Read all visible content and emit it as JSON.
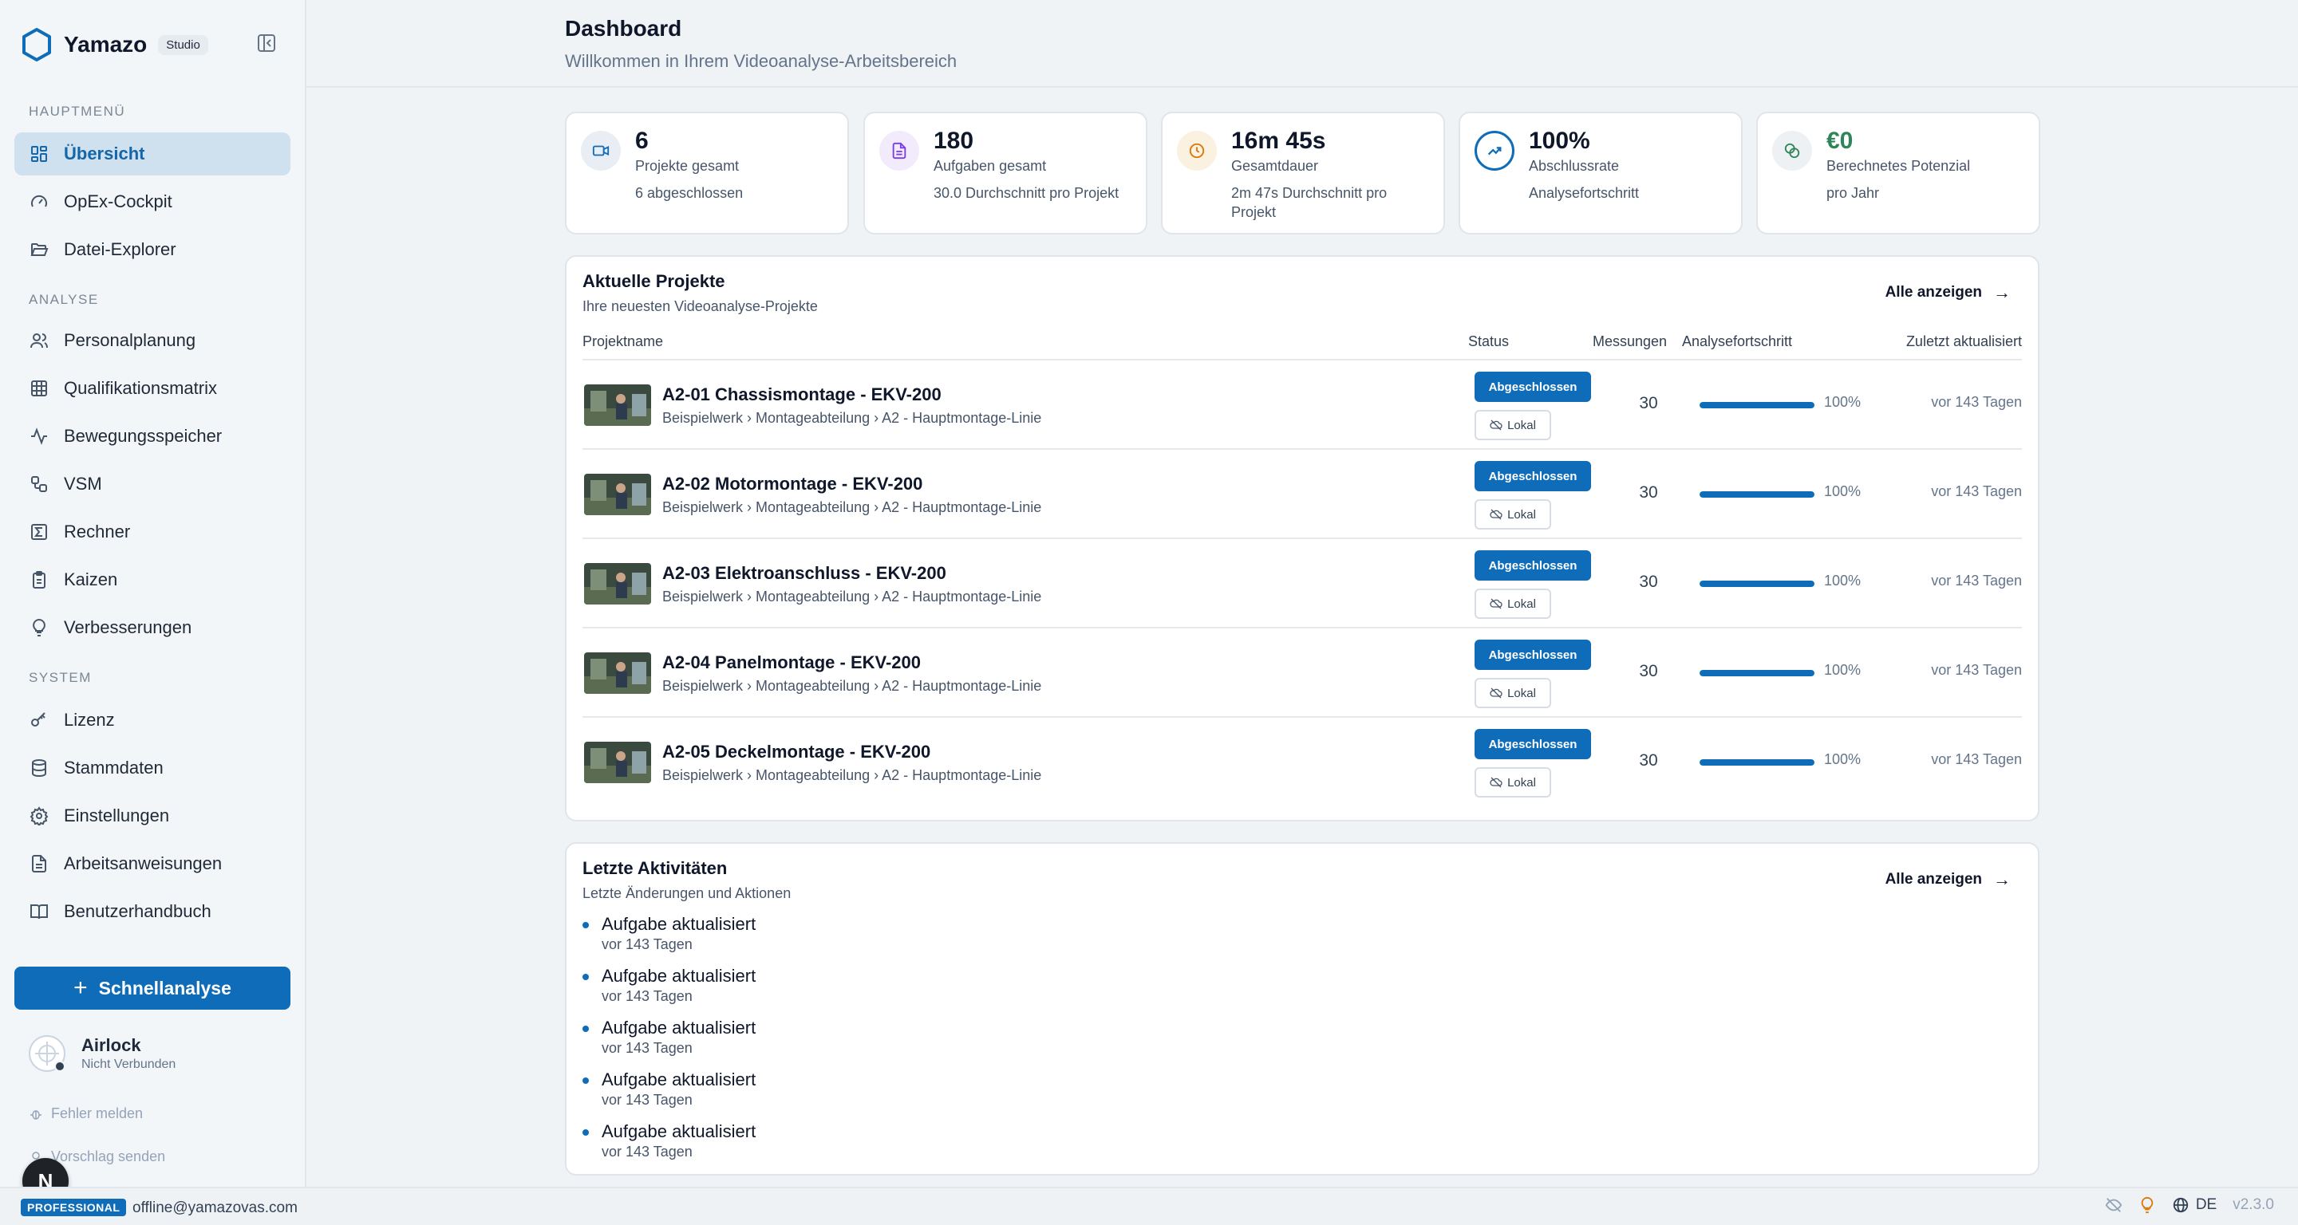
{
  "brand": {
    "name": "Yamazo",
    "badge": "Studio"
  },
  "sidebar": {
    "sections": [
      {
        "title": "HAUPTMENÜ",
        "items": [
          {
            "label": "Übersicht",
            "icon": "dashboard-icon",
            "active": true
          },
          {
            "label": "OpEx-Cockpit",
            "icon": "gauge-icon"
          },
          {
            "label": "Datei-Explorer",
            "icon": "folder-open-icon"
          }
        ]
      },
      {
        "title": "ANALYSE",
        "items": [
          {
            "label": "Personalplanung",
            "icon": "users-icon"
          },
          {
            "label": "Qualifikationsmatrix",
            "icon": "grid-icon"
          },
          {
            "label": "Bewegungsspeicher",
            "icon": "activity-icon"
          },
          {
            "label": "VSM",
            "icon": "workflow-icon"
          },
          {
            "label": "Rechner",
            "icon": "sigma-icon"
          },
          {
            "label": "Kaizen",
            "icon": "clipboard-icon"
          },
          {
            "label": "Verbesserungen",
            "icon": "lightbulb-icon"
          }
        ]
      },
      {
        "title": "SYSTEM",
        "items": [
          {
            "label": "Lizenz",
            "icon": "key-icon"
          },
          {
            "label": "Stammdaten",
            "icon": "database-icon"
          },
          {
            "label": "Einstellungen",
            "icon": "gear-icon"
          },
          {
            "label": "Arbeitsanweisungen",
            "icon": "file-text-icon"
          },
          {
            "label": "Benutzerhandbuch",
            "icon": "book-icon"
          }
        ]
      }
    ],
    "quick_button": "Schnellanalyse",
    "airlock": {
      "name": "Airlock",
      "status": "Nicht Verbunden"
    },
    "report_bug": "Fehler melden",
    "suggest": "Vorschlag senden",
    "bubble": "N"
  },
  "header": {
    "title": "Dashboard",
    "subtitle": "Willkommen in Ihrem Videoanalyse-Arbeitsbereich"
  },
  "stats": [
    {
      "value": "6",
      "label": "Projekte gesamt",
      "sub": "6 abgeschlossen",
      "icon": "video-icon",
      "color": "#0f6cb8"
    },
    {
      "value": "180",
      "label": "Aufgaben gesamt",
      "sub": "30.0 Durchschnitt pro Projekt",
      "icon": "document-icon",
      "color": "#7c3aed"
    },
    {
      "value": "16m 45s",
      "label": "Gesamtdauer",
      "sub": "2m 47s Durchschnitt pro Projekt",
      "icon": "clock-icon",
      "color": "#d97706"
    },
    {
      "value": "100%",
      "label": "Abschlussrate",
      "sub": "Analysefortschritt",
      "icon": "trending-up-icon",
      "color": "#0f6cb8"
    },
    {
      "value": "€0",
      "label": "Berechnetes Potenzial",
      "sub": "pro Jahr",
      "icon": "coins-icon",
      "color": "#2f855a"
    }
  ],
  "projects": {
    "title": "Aktuelle Projekte",
    "subtitle": "Ihre neuesten Videoanalyse-Projekte",
    "show_all": "Alle anzeigen",
    "columns": [
      "Projektname",
      "Status",
      "Messungen",
      "Analysefortschritt",
      "Zuletzt aktualisiert"
    ],
    "rows": [
      {
        "name": "A2-01 Chassismontage - EKV-200",
        "path": "Beispielwerk › Montageabteilung › A2 - Hauptmontage-Linie",
        "status": "Abgeschlossen",
        "storage": "Lokal",
        "measurements": "30",
        "progress": 100,
        "progress_label": "100%",
        "updated": "vor 143 Tagen"
      },
      {
        "name": "A2-02 Motormontage - EKV-200",
        "path": "Beispielwerk › Montageabteilung › A2 - Hauptmontage-Linie",
        "status": "Abgeschlossen",
        "storage": "Lokal",
        "measurements": "30",
        "progress": 100,
        "progress_label": "100%",
        "updated": "vor 143 Tagen"
      },
      {
        "name": "A2-03 Elektroanschluss - EKV-200",
        "path": "Beispielwerk › Montageabteilung › A2 - Hauptmontage-Linie",
        "status": "Abgeschlossen",
        "storage": "Lokal",
        "measurements": "30",
        "progress": 100,
        "progress_label": "100%",
        "updated": "vor 143 Tagen"
      },
      {
        "name": "A2-04 Panelmontage - EKV-200",
        "path": "Beispielwerk › Montageabteilung › A2 - Hauptmontage-Linie",
        "status": "Abgeschlossen",
        "storage": "Lokal",
        "measurements": "30",
        "progress": 100,
        "progress_label": "100%",
        "updated": "vor 143 Tagen"
      },
      {
        "name": "A2-05 Deckelmontage - EKV-200",
        "path": "Beispielwerk › Montageabteilung › A2 - Hauptmontage-Linie",
        "status": "Abgeschlossen",
        "storage": "Lokal",
        "measurements": "30",
        "progress": 100,
        "progress_label": "100%",
        "updated": "vor 143 Tagen"
      }
    ]
  },
  "activity": {
    "title": "Letzte Aktivitäten",
    "subtitle": "Letzte Änderungen und Aktionen",
    "show_all": "Alle anzeigen",
    "items": [
      {
        "title": "Aufgabe aktualisiert",
        "time": "vor 143 Tagen"
      },
      {
        "title": "Aufgabe aktualisiert",
        "time": "vor 143 Tagen"
      },
      {
        "title": "Aufgabe aktualisiert",
        "time": "vor 143 Tagen"
      },
      {
        "title": "Aufgabe aktualisiert",
        "time": "vor 143 Tagen"
      },
      {
        "title": "Aufgabe aktualisiert",
        "time": "vor 143 Tagen"
      }
    ]
  },
  "footer": {
    "plan": "PROFESSIONAL",
    "email": "offline@yamazovas.com",
    "language": "DE",
    "version": "v2.3.0"
  }
}
